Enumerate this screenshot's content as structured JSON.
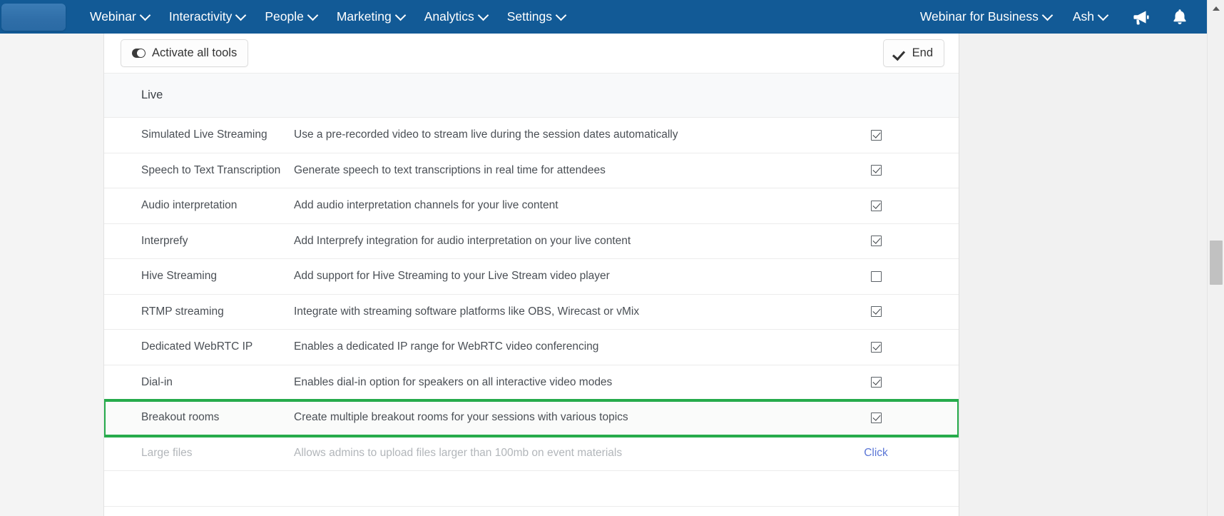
{
  "topnav": {
    "logo_alt": "brand-logo",
    "left_items": [
      {
        "label": "Webinar",
        "has_caret": true
      },
      {
        "label": "Interactivity",
        "has_caret": true
      },
      {
        "label": "People",
        "has_caret": true
      },
      {
        "label": "Marketing",
        "has_caret": true
      },
      {
        "label": "Analytics",
        "has_caret": true
      },
      {
        "label": "Settings",
        "has_caret": true
      }
    ],
    "right_items": [
      {
        "label": "Webinar for Business",
        "has_caret": true
      },
      {
        "label": "Ash",
        "has_caret": true
      }
    ],
    "icons": [
      {
        "name": "megaphone-icon"
      },
      {
        "name": "bell-icon"
      }
    ],
    "bg_color": "#125a96"
  },
  "toolbar": {
    "activate_all_label": "Activate all tools",
    "end_label": "End"
  },
  "section": {
    "title": "Live"
  },
  "table": {
    "rows": [
      {
        "name": "Simulated Live Streaming",
        "description": "Use a pre-recorded video to stream live during the session dates automatically",
        "control": "checkbox",
        "checked": true,
        "disabled": false,
        "highlighted": false
      },
      {
        "name": "Speech to Text Transcription",
        "description": "Generate speech to text transcriptions in real time for attendees",
        "control": "checkbox",
        "checked": true,
        "disabled": false,
        "highlighted": false
      },
      {
        "name": "Audio interpretation",
        "description": "Add audio interpretation channels for your live content",
        "control": "checkbox",
        "checked": true,
        "disabled": false,
        "highlighted": false
      },
      {
        "name": "Interprefy",
        "description": "Add Interprefy integration for audio interpretation on your live content",
        "control": "checkbox",
        "checked": true,
        "disabled": false,
        "highlighted": false
      },
      {
        "name": "Hive Streaming",
        "description": "Add support for Hive Streaming to your Live Stream video player",
        "control": "checkbox",
        "checked": false,
        "disabled": false,
        "highlighted": false
      },
      {
        "name": "RTMP streaming",
        "description": "Integrate with streaming software platforms like OBS, Wirecast or vMix",
        "control": "checkbox",
        "checked": true,
        "disabled": false,
        "highlighted": false
      },
      {
        "name": "Dedicated WebRTC IP",
        "description": "Enables a dedicated IP range for WebRTC video conferencing",
        "control": "checkbox",
        "checked": true,
        "disabled": false,
        "highlighted": false
      },
      {
        "name": "Dial-in",
        "description": "Enables dial-in option for speakers on all interactive video modes",
        "control": "checkbox",
        "checked": true,
        "disabled": false,
        "highlighted": false
      },
      {
        "name": "Breakout rooms",
        "description": "Create multiple breakout rooms for your sessions with various topics",
        "control": "checkbox",
        "checked": true,
        "disabled": false,
        "highlighted": true
      },
      {
        "name": "Large files",
        "description": "Allows admins to upload files larger than 100mb on event materials",
        "control": "link",
        "link_label": "Click",
        "checked": false,
        "disabled": true,
        "highlighted": false
      }
    ]
  },
  "colors": {
    "nav_bg": "#125a96",
    "highlight_outline": "#26ab4b",
    "link": "#5b76d6",
    "panel_bg": "#ffffff",
    "page_bg": "#f1f1f1"
  }
}
